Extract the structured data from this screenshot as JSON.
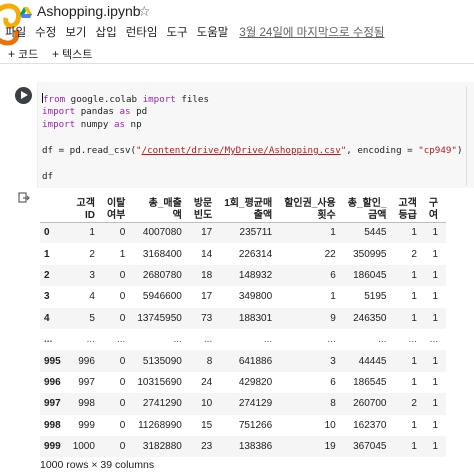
{
  "header": {
    "title": "Ashopping.ipynb",
    "menu": [
      "파일",
      "수정",
      "보기",
      "삽입",
      "런타임",
      "도구",
      "도움말"
    ],
    "last_edit": "3월 24일에 마지막으로 수정됨"
  },
  "toolbar": {
    "code_label": "코드",
    "text_label": "텍스트"
  },
  "code": {
    "l1_from": "from",
    "l1_mod": " google.colab ",
    "l1_import": "import",
    "l1_name": " files",
    "l2_import": "import",
    "l2_mod": " pandas ",
    "l2_as": "as",
    "l2_alias": " pd",
    "l3_import": "import",
    "l3_mod": " numpy ",
    "l3_as": "as",
    "l3_alias": " np",
    "l4_a": "df = pd.read_csv(",
    "l4_q1": "\"",
    "l4_path": "/content/drive/MyDrive/Ashopping.csv",
    "l4_q2": "\"",
    "l4_b": ", encoding = ",
    "l4_enc": "\"cp949\"",
    "l4_c": ")",
    "l5": "df"
  },
  "table": {
    "columns": [
      "",
      "고객\nID",
      "이탈\n여부",
      "총_매출\n액",
      "방문\n빈도",
      "1회_평균매\n출액",
      "할인권_사용\n횟수",
      "총_할인_\n금액",
      "고객\n등급",
      "구\n여"
    ],
    "rows": [
      [
        "0",
        "1",
        "0",
        "4007080",
        "17",
        "235711",
        "1",
        "5445",
        "1",
        "1"
      ],
      [
        "1",
        "2",
        "1",
        "3168400",
        "14",
        "226314",
        "22",
        "350995",
        "2",
        "1"
      ],
      [
        "2",
        "3",
        "0",
        "2680780",
        "18",
        "148932",
        "6",
        "186045",
        "1",
        "1"
      ],
      [
        "3",
        "4",
        "0",
        "5946600",
        "17",
        "349800",
        "1",
        "5195",
        "1",
        "1"
      ],
      [
        "4",
        "5",
        "0",
        "13745950",
        "73",
        "188301",
        "9",
        "246350",
        "1",
        "1"
      ],
      [
        "...",
        "...",
        "...",
        "...",
        "...",
        "...",
        "...",
        "...",
        "...",
        "..."
      ],
      [
        "995",
        "996",
        "0",
        "5135090",
        "8",
        "641886",
        "3",
        "44445",
        "1",
        "1"
      ],
      [
        "996",
        "997",
        "0",
        "10315690",
        "24",
        "429820",
        "6",
        "186545",
        "1",
        "1"
      ],
      [
        "997",
        "998",
        "0",
        "2741290",
        "10",
        "274129",
        "8",
        "260700",
        "2",
        "1"
      ],
      [
        "998",
        "999",
        "0",
        "11268990",
        "15",
        "751266",
        "10",
        "162370",
        "1",
        "1"
      ],
      [
        "999",
        "1000",
        "0",
        "3182880",
        "23",
        "138386",
        "19",
        "367045",
        "1",
        "1"
      ]
    ],
    "summary": "1000 rows × 39 columns"
  },
  "icons": {
    "logo": "colab-logo-icon",
    "drive": "drive-icon",
    "star": "star-icon",
    "run": "play-icon",
    "output": "output-redirect-icon"
  },
  "colors": {
    "keyword": "#9c27b0",
    "string": "#b71c1c",
    "logo_orange": "#f9ab00",
    "logo_dark": "#e8710a"
  }
}
